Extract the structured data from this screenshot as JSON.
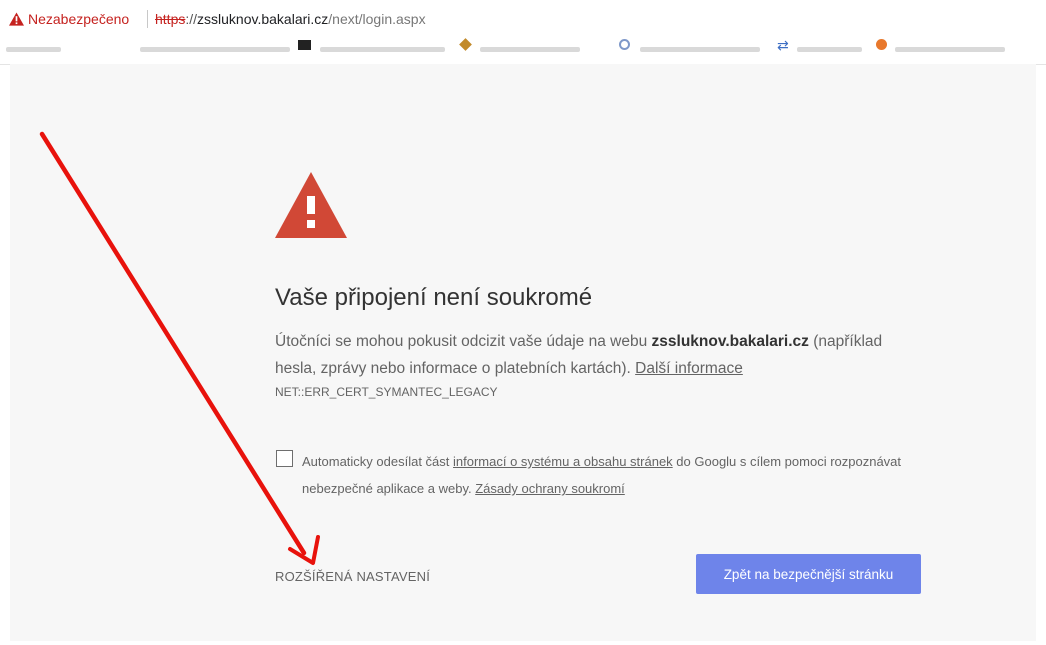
{
  "address_bar": {
    "security_label": "Nezabezpečeno",
    "url_scheme": "https",
    "url_rest_separator": "://",
    "url_host": "zssluknov.bakalari.cz",
    "url_path": "/next/login.aspx"
  },
  "interstitial": {
    "title": "Vaše připojení není soukromé",
    "desc_part1": "Útočníci se mohou pokusit odcizit vaše údaje na webu ",
    "desc_host": "zssluknov.bakalari.cz",
    "desc_part2": " (například hesla, zprávy nebo informace o platebních kartách). ",
    "more_info_link": "Další informace",
    "error_code": "NET::ERR_CERT_SYMANTEC_LEGACY",
    "opt_in_part1": "Automaticky odesílat část ",
    "opt_in_link": "informací o systému a obsahu stránek",
    "opt_in_part2": " do Googlu s cílem pomoci rozpoznávat nebezpečné aplikace a weby. ",
    "privacy_link": "Zásady ochrany soukromí",
    "advanced_button": "ROZŠÍŘENÁ NASTAVENÍ",
    "back_button": "Zpět na bezpečnější stránku"
  },
  "colors": {
    "warning_red": "#d14836",
    "annotation_red": "#e8120c",
    "primary_button": "#6e84ea",
    "page_background": "#f7f7f7"
  }
}
